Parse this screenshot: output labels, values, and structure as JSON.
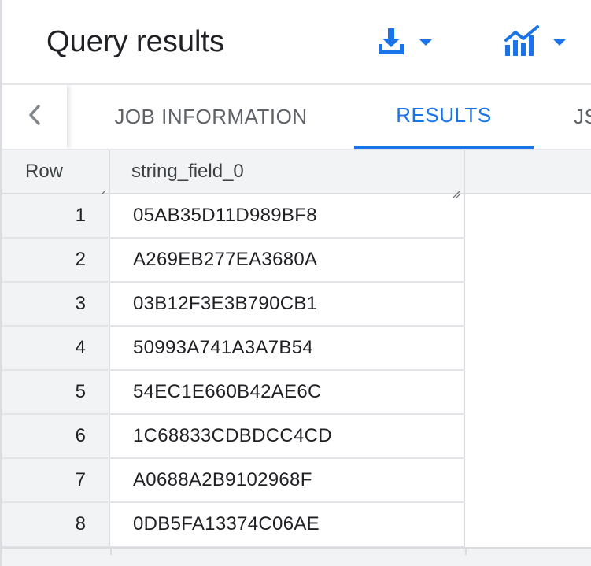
{
  "header": {
    "title": "Query results",
    "download_icon": "download-icon",
    "explore_icon": "chart-explore-icon",
    "accent_color": "#1a73e8"
  },
  "tabs": {
    "back_icon": "chevron-left-icon",
    "items": [
      {
        "label": "JOB INFORMATION",
        "active": false
      },
      {
        "label": "RESULTS",
        "active": true
      },
      {
        "label": "JSON",
        "active": false
      }
    ]
  },
  "grid": {
    "columns": [
      "Row",
      "string_field_0"
    ],
    "rows": [
      {
        "row": "1",
        "value": "05AB35D11D989BF8"
      },
      {
        "row": "2",
        "value": "A269EB277EA3680A"
      },
      {
        "row": "3",
        "value": "03B12F3E3B790CB1"
      },
      {
        "row": "4",
        "value": "50993A741A3A7B54"
      },
      {
        "row": "5",
        "value": "54EC1E660B42AE6C"
      },
      {
        "row": "6",
        "value": "1C68833CDBDCC4CD"
      },
      {
        "row": "7",
        "value": "A0688A2B9102968F"
      },
      {
        "row": "8",
        "value": "0DB5FA13374C06AE"
      }
    ]
  }
}
